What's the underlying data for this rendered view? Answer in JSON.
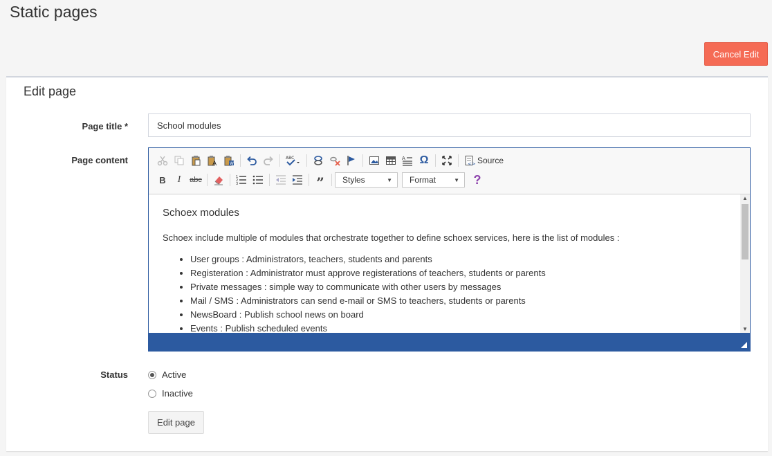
{
  "header": {
    "title": "Static pages",
    "cancel_label": "Cancel Edit"
  },
  "panel": {
    "title": "Edit page"
  },
  "form": {
    "title_label": "Page title *",
    "title_value": "School modules",
    "content_label": "Page content",
    "status_label": "Status",
    "status_options": [
      {
        "label": "Active",
        "checked": true
      },
      {
        "label": "Inactive",
        "checked": false
      }
    ],
    "submit_label": "Edit page"
  },
  "editor": {
    "toolbar": {
      "source_label": "Source",
      "styles_label": "Styles",
      "format_label": "Format"
    },
    "content": {
      "heading": "Schoex modules",
      "intro": "Schoex include multiple of modules that orchestrate together to define schoex services, here is the list of modules :",
      "items": [
        "User groups : Administrators, teachers, students and parents",
        "Registeration : Administrator must approve registerations of teachers, students or parents",
        "Private messages : simple way to communicate with other users by messages",
        "Mail / SMS : Administrators can send e-mail or SMS to teachers, students or parents",
        "NewsBoard : Publish school news on board",
        "Events : Publish scheduled events"
      ]
    }
  },
  "colors": {
    "accent": "#2c5aa0",
    "danger": "#f56b55"
  }
}
